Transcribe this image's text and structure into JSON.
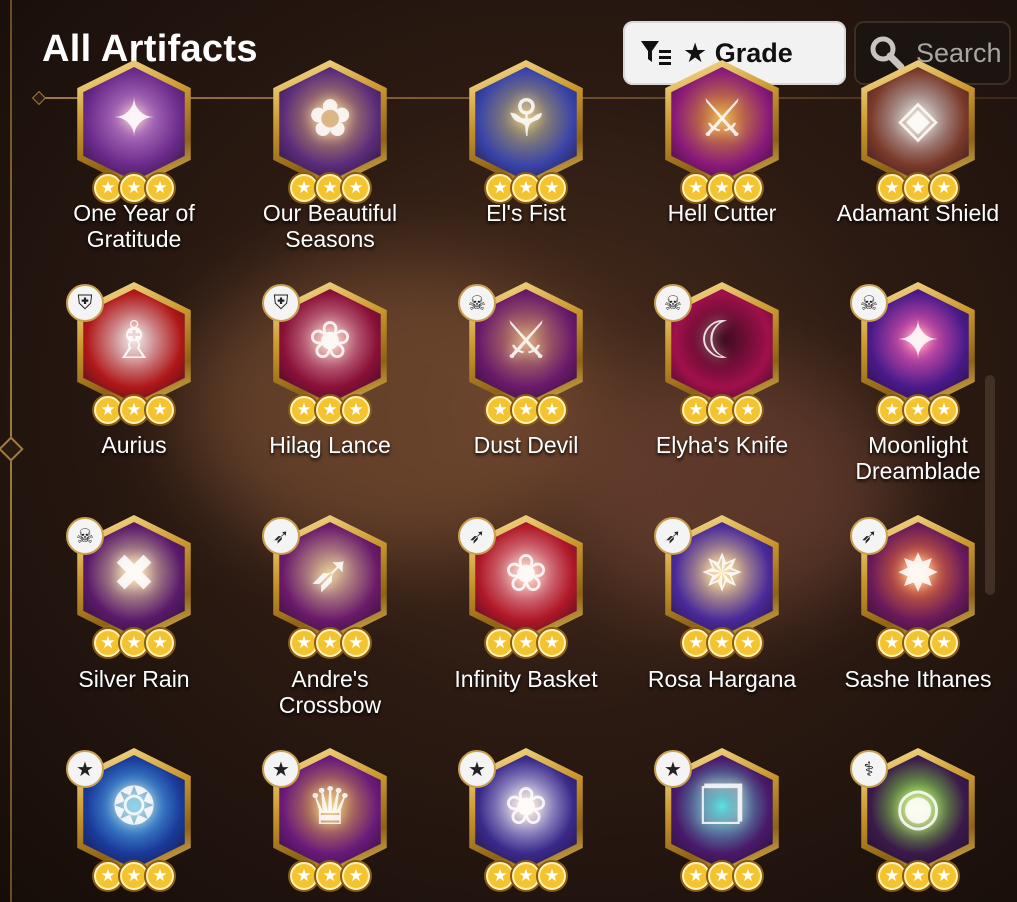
{
  "header": {
    "title": "All Artifacts",
    "sort_button_label": "★ Grade",
    "search_button_label": "Search"
  },
  "artifacts": [
    {
      "name": "One Year of Gratitude",
      "stars": 3,
      "class_icon": "none",
      "glyph": "✦",
      "colors": [
        "#6a2a8a",
        "#c78bd0"
      ]
    },
    {
      "name": "Our Beautiful Seasons",
      "stars": 3,
      "class_icon": "none",
      "glyph": "✿",
      "colors": [
        "#5b2c7a",
        "#d4a860"
      ]
    },
    {
      "name": "El's Fist",
      "stars": 3,
      "class_icon": "none",
      "glyph": "⚘",
      "colors": [
        "#3a44a8",
        "#b9a450"
      ]
    },
    {
      "name": "Hell Cutter",
      "stars": 3,
      "class_icon": "none",
      "glyph": "⚔",
      "colors": [
        "#8a1a7a",
        "#e0a020"
      ]
    },
    {
      "name": "Adamant Shield",
      "stars": 3,
      "class_icon": "none",
      "glyph": "◈",
      "colors": [
        "#7a3a2a",
        "#cfd8e0"
      ]
    },
    {
      "name": "Aurius",
      "stars": 3,
      "class_icon": "knight",
      "glyph": "♗",
      "colors": [
        "#b01818",
        "#e8e8f0"
      ]
    },
    {
      "name": "Hilag Lance",
      "stars": 3,
      "class_icon": "knight",
      "glyph": "❀",
      "colors": [
        "#8a1038",
        "#e8b0b8"
      ]
    },
    {
      "name": "Dust Devil",
      "stars": 3,
      "class_icon": "thief",
      "glyph": "⚔",
      "colors": [
        "#6a1a6a",
        "#c89060"
      ]
    },
    {
      "name": "Elyha's Knife",
      "stars": 3,
      "class_icon": "thief",
      "glyph": "☾",
      "colors": [
        "#a0104a",
        "#3a0a20"
      ]
    },
    {
      "name": "Moonlight Dreamblade",
      "stars": 3,
      "class_icon": "thief",
      "glyph": "✦",
      "colors": [
        "#4a1a8a",
        "#ff60b0"
      ]
    },
    {
      "name": "Silver Rain",
      "stars": 3,
      "class_icon": "thief",
      "glyph": "✖",
      "colors": [
        "#5a1a6a",
        "#e8d8a0"
      ]
    },
    {
      "name": "Andre's Crossbow",
      "stars": 3,
      "class_icon": "ranger",
      "glyph": "➶",
      "colors": [
        "#6a1a6a",
        "#e0c890"
      ]
    },
    {
      "name": "Infinity Basket",
      "stars": 3,
      "class_icon": "ranger",
      "glyph": "❀",
      "colors": [
        "#b01828",
        "#f0c0c8"
      ]
    },
    {
      "name": "Rosa Hargana",
      "stars": 3,
      "class_icon": "ranger",
      "glyph": "✵",
      "colors": [
        "#4a2a9a",
        "#ffe080"
      ]
    },
    {
      "name": "Sashe Ithanes",
      "stars": 3,
      "class_icon": "ranger",
      "glyph": "✸",
      "colors": [
        "#6a1a5a",
        "#ff8030"
      ]
    },
    {
      "name": "",
      "stars": 3,
      "class_icon": "mage",
      "glyph": "❂",
      "colors": [
        "#1a3a9a",
        "#60d0ff"
      ]
    },
    {
      "name": "",
      "stars": 3,
      "class_icon": "mage",
      "glyph": "♛",
      "colors": [
        "#6a1a7a",
        "#e0b040"
      ]
    },
    {
      "name": "",
      "stars": 3,
      "class_icon": "mage",
      "glyph": "❀",
      "colors": [
        "#3a2a8a",
        "#f0f0ff"
      ]
    },
    {
      "name": "",
      "stars": 3,
      "class_icon": "mage",
      "glyph": "❐",
      "colors": [
        "#4a1a6a",
        "#60e0e0"
      ]
    },
    {
      "name": "",
      "stars": 3,
      "class_icon": "soul-weaver",
      "glyph": "◉",
      "colors": [
        "#3a1a4a",
        "#90ff40"
      ]
    }
  ],
  "class_badge_glyphs": {
    "knight": "⛨",
    "thief": "☠",
    "ranger": "➶",
    "mage": "★",
    "soul-weaver": "⚕"
  }
}
